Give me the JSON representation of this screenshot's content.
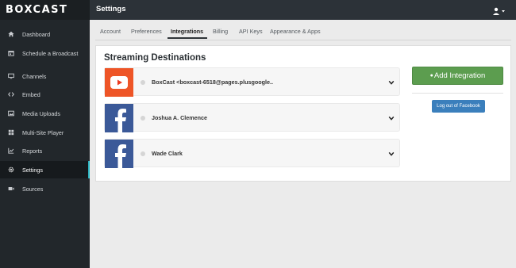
{
  "brand": {
    "logo_text": "BOXCAST"
  },
  "header": {
    "title": "Settings"
  },
  "sidebar": {
    "items": [
      {
        "label": "Dashboard",
        "icon": "home-icon"
      },
      {
        "label": "Schedule a Broadcast",
        "icon": "calendar-icon"
      },
      {
        "label": "Channels",
        "icon": "monitor-icon"
      },
      {
        "label": "Embed",
        "icon": "code-icon"
      },
      {
        "label": "Media Uploads",
        "icon": "image-icon"
      },
      {
        "label": "Multi-Site Player",
        "icon": "grid-icon"
      },
      {
        "label": "Reports",
        "icon": "chart-icon"
      },
      {
        "label": "Settings",
        "icon": "gear-icon",
        "active": true
      },
      {
        "label": "Sources",
        "icon": "video-camera-icon"
      }
    ]
  },
  "tabs": [
    {
      "label": "Account"
    },
    {
      "label": "Preferences"
    },
    {
      "label": "Integrations",
      "active": true
    },
    {
      "label": "Billing"
    },
    {
      "label": "API Keys"
    },
    {
      "label": "Appearance & Apps"
    }
  ],
  "main": {
    "section_title": "Streaming Destinations",
    "destinations": [
      {
        "name": "BoxCast <boxcast-6518@pages.plusgoogle..",
        "service": "youtube",
        "color": "#ee5527"
      },
      {
        "name": "Joshua A. Clemence",
        "service": "facebook",
        "color": "#3b5998"
      },
      {
        "name": "Wade Clark",
        "service": "facebook",
        "color": "#3b5998"
      }
    ],
    "add_button": "Add Integration",
    "logout_button": "Log out of Facebook"
  },
  "colors": {
    "sidebar": "#22272b",
    "accent": "#2bb3c0",
    "add_button": "#5c9d4f",
    "logout_button": "#3b7fbc"
  }
}
